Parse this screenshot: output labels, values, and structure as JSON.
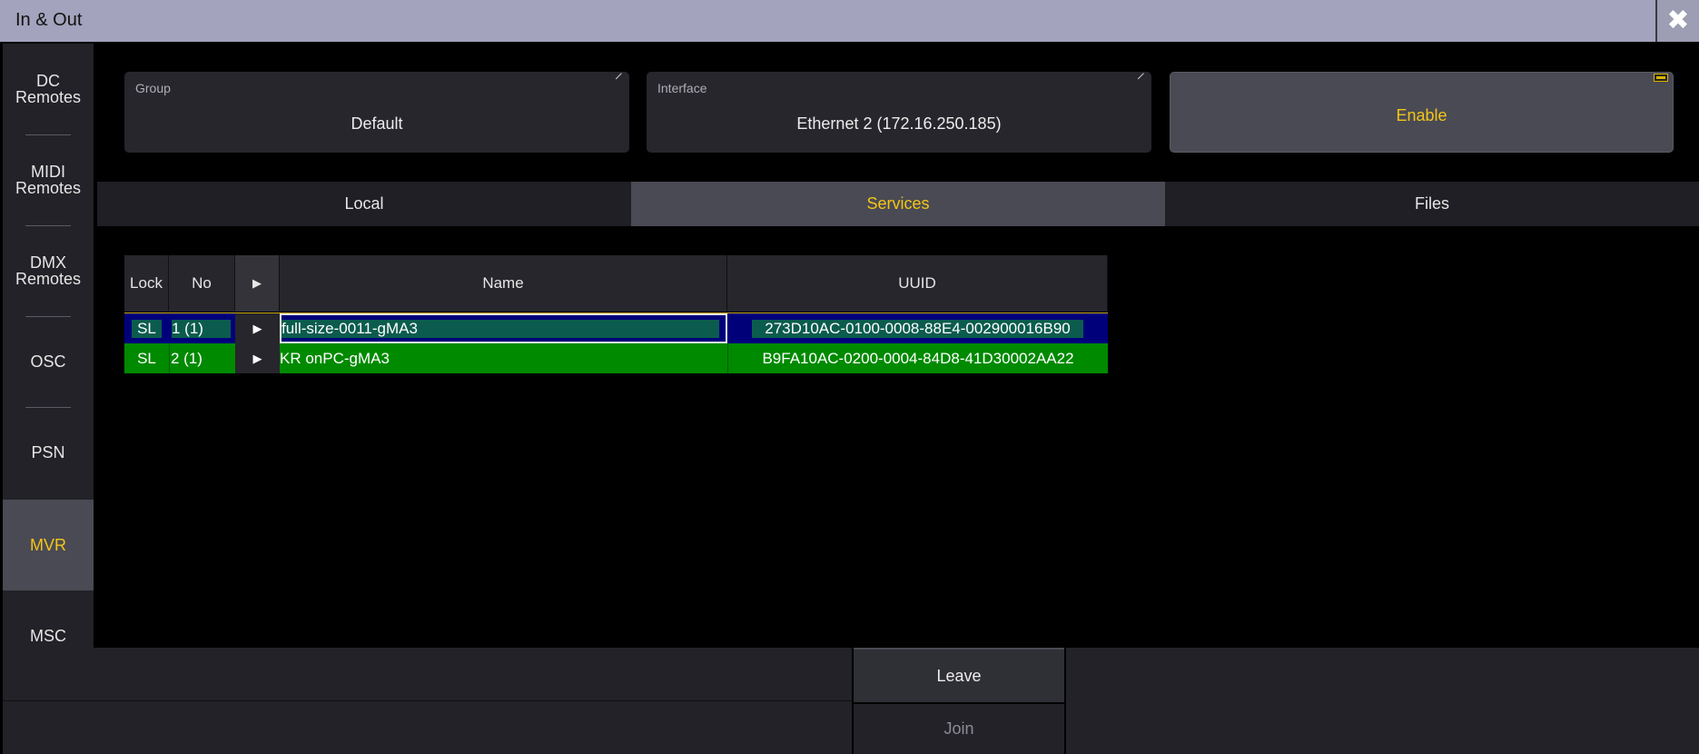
{
  "window": {
    "title": "In & Out",
    "close_icon": "close-icon"
  },
  "sidebar": {
    "items": [
      {
        "label": "DC\nRemotes"
      },
      {
        "label": "MIDI\nRemotes"
      },
      {
        "label": "DMX\nRemotes"
      },
      {
        "label": "OSC"
      },
      {
        "label": "PSN"
      },
      {
        "label": "MVR",
        "active": true
      },
      {
        "label": "MSC"
      }
    ]
  },
  "settings": {
    "group": {
      "label": "Group",
      "value": "Default"
    },
    "interface": {
      "label": "Interface",
      "value": "Ethernet 2 (172.16.250.185)"
    },
    "enable": {
      "label": "Enable"
    }
  },
  "tabs": [
    {
      "label": "Local"
    },
    {
      "label": "Services",
      "active": true
    },
    {
      "label": "Files"
    }
  ],
  "table": {
    "headers": {
      "lock": "Lock",
      "no": "No",
      "play": "▶",
      "name": "Name",
      "uuid": "UUID"
    },
    "rows": [
      {
        "lock": "SL",
        "no": "1 (1)",
        "play": "▶",
        "name": "full-size-0011-gMA3",
        "uuid": "273D10AC-0100-0008-88E4-002900016B90",
        "selected": true
      },
      {
        "lock": "SL",
        "no": "2 (1)",
        "play": "▶",
        "name": "KR onPC-gMA3",
        "uuid": "B9FA10AC-0200-0004-84D8-41D30002AA22",
        "selected": false
      }
    ]
  },
  "footer": {
    "leave": "Leave",
    "join": "Join"
  },
  "colors": {
    "accent": "#f3c517",
    "row_selected": "#00007a",
    "row_green": "#008a00",
    "row_cell_teal": "#0b5c4e"
  }
}
